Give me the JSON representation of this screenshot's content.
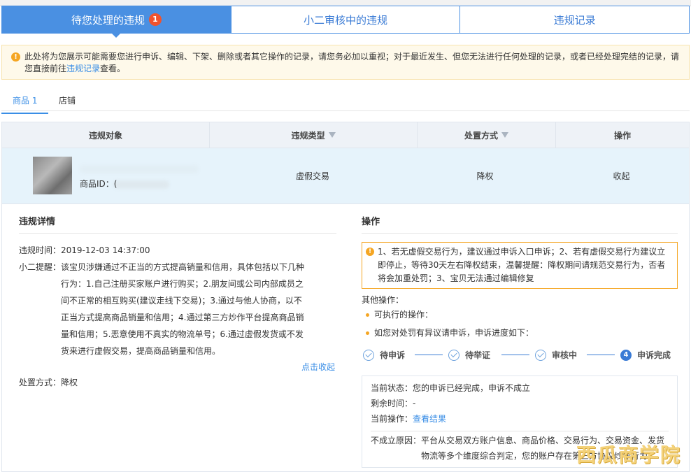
{
  "tabs": {
    "pending_label": "待您处理的违规",
    "pending_badge": "1",
    "reviewing_label": "小二审核中的违规",
    "records_label": "违规记录"
  },
  "notice": {
    "text": "此处将为您展示可能需要您进行申诉、编辑、下架、删除或者其它操作的记录，请您务必加以重视；对于最近发生、但您无法进行任何处理的记录，或者已经处理完结的记录，请您直接前往",
    "link": "违规记录",
    "tail": "查看。"
  },
  "subtabs": {
    "goods": "商品 1",
    "shop": "店铺"
  },
  "table": {
    "headers": [
      "违规对象",
      "违规类型",
      "处置方式",
      "操作"
    ],
    "row": {
      "product_id_label": "商品ID：(",
      "type": "虚假交易",
      "action": "降权",
      "op": "收起"
    }
  },
  "detail": {
    "title": "违规详情",
    "time_label": "违规时间：",
    "time": "2019-12-03 14:37:00",
    "reminder_label": "小二提醒：",
    "reminder_first": "该宝贝涉嫌通过不正当的方式提高销量和信用，具体包括以下几种",
    "reminder_rest": "行为：1.自己注册买家账户进行购买；2.朋友间或公司内部成员之间不正常的相互购买(建议走线下交易)；3.通过与他人协商，以不正当方式提高商品销量和信用；4.通过第三方炒作平台提高商品销量和信用；5.恶意使用不真实的物流单号；6.通过虚假发货或不发货来进行虚假交易，提高商品销量和信用。",
    "collapse_link": "点击收起",
    "handle_label": "处置方式：",
    "handle_value": "降权"
  },
  "operation": {
    "title": "操作",
    "tip": "1、若无虚假交易行为，建议通过申诉入口申诉；2、若有虚假交易行为建议立即停止，等待30天左右降权结束，温馨提醒：降权期间请规范交易行为，否者将会加重处罚；3、宝贝无法通过编辑修复",
    "other_label": "其他操作：",
    "executable": "可执行的操作：",
    "appeal_line": "如您对处罚有异议请申诉，申诉进度如下：",
    "steps": [
      "待申诉",
      "待举证",
      "审核中",
      "申诉完成"
    ],
    "current_step_num": "4",
    "status_label": "当前状态：",
    "status_value": "您的申诉已经完成，申诉不成立",
    "remain_label": "剩余时间：",
    "remain_value": "-",
    "cur_op_label": "当前操作：",
    "cur_op_link": "查看结果",
    "reason_label": "不成立原因：",
    "reason_value": "平台从交易双方账户信息、商品价格、交易行为、交易资金、发货物流等多个维度综合判定，您的账户存在第三方协议炒作行为"
  },
  "watermark": "西瓜商学院",
  "colors": {
    "primary": "#4a90e2",
    "badge": "#f0522d",
    "warning": "#f5a623",
    "link": "#3a8ee6"
  }
}
